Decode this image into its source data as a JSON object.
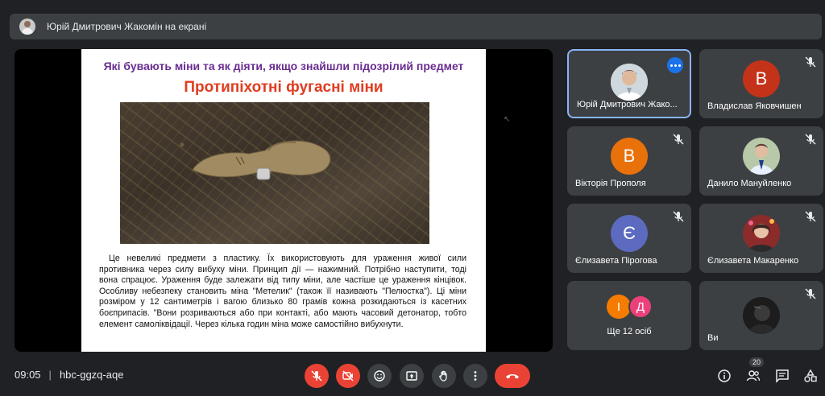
{
  "presenter_bar": {
    "text": "Юрій Дмитрович Жакомін на екрані"
  },
  "slide": {
    "title": "Які бувають міни та як діяти, якщо знайшли підозрілий предмет",
    "subtitle": "Протипіхотні фугасні міни",
    "body": "Це невеликі предмети з пластику. Їх використовують для ураження живої сили противника через силу вибуху міни. Принцип дії — нажимний. Потрібно наступити, тоді вона спрацює. Ураження буде залежати від типу міни, але частіше це ураження кінцівок. Особливу небезпеку становить міна \"Метелик\" (також її називають \"Пелюстка\"). Ці міни розміром у 12 сантиметрів і вагою близько 80 грамів кожна розкидаються із касетних боєприпасів. \"Вони розриваються або при контакті, або мають часовий детонатор, тобто елемент самоліквідації. Через кілька годин міна може самостійно вибухнути."
  },
  "participants": [
    {
      "name": "Юрій Дмитрович Жако...",
      "type": "photo",
      "active": true
    },
    {
      "name": "Владислав Яковчишен",
      "letter": "В",
      "color": "#c5321a",
      "muted": true
    },
    {
      "name": "Вікторія Прополя",
      "letter": "В",
      "color": "#e8710a",
      "muted": true
    },
    {
      "name": "Данило Мануйленко",
      "type": "photo",
      "muted": true
    },
    {
      "name": "Єлизавета Пірогова",
      "letter": "Є",
      "color": "#5c6bc0",
      "muted": true
    },
    {
      "name": "Єлизавета Макаренко",
      "type": "photo",
      "muted": true
    },
    {
      "name": "Ще 12 осіб",
      "letters": [
        "І",
        "Д"
      ],
      "colors": [
        "#f57c00",
        "#ec407a"
      ]
    },
    {
      "name": "Ви",
      "type": "photo",
      "muted": true
    }
  ],
  "bottom": {
    "time": "09:05",
    "separator": "|",
    "meeting_code": "hbc-ggzq-aqe",
    "people_count": "20"
  }
}
